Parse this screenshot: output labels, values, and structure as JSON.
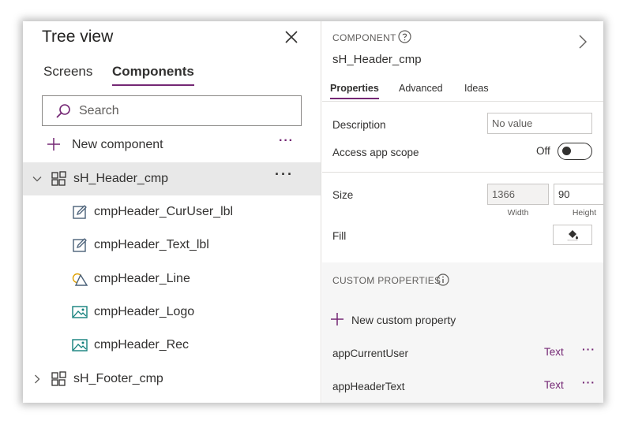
{
  "tree_view": {
    "title": "Tree view",
    "tabs": [
      {
        "label": "Screens",
        "active": false
      },
      {
        "label": "Components",
        "active": true
      }
    ],
    "search_placeholder": "Search",
    "new_component_label": "New component",
    "more_label": "···",
    "items": [
      {
        "name": "sH_Header_cmp",
        "type": "component",
        "expanded": true,
        "selected": true,
        "more": "···"
      },
      {
        "name": "cmpHeader_CurUser_lbl",
        "type": "label",
        "icon": "edit-label-icon"
      },
      {
        "name": "cmpHeader_Text_lbl",
        "type": "label",
        "icon": "edit-label-icon"
      },
      {
        "name": "cmpHeader_Line",
        "type": "shape",
        "icon": "shapes-icon"
      },
      {
        "name": "cmpHeader_Logo",
        "type": "image",
        "icon": "image-icon"
      },
      {
        "name": "cmpHeader_Rec",
        "type": "image",
        "icon": "image-icon"
      },
      {
        "name": "sH_Footer_cmp",
        "type": "component",
        "expanded": false,
        "selected": false
      }
    ]
  },
  "properties_panel": {
    "section_label": "COMPONENT",
    "component_name": "sH_Header_cmp",
    "tabs": [
      {
        "label": "Properties",
        "active": true
      },
      {
        "label": "Advanced",
        "active": false
      },
      {
        "label": "Ideas",
        "active": false
      }
    ],
    "description": {
      "label": "Description",
      "placeholder": "No value"
    },
    "access_app_scope": {
      "label": "Access app scope",
      "state_text": "Off",
      "on": false
    },
    "size": {
      "label": "Size",
      "width": "1366",
      "width_label": "Width",
      "height": "90",
      "height_label": "Height"
    },
    "fill": {
      "label": "Fill",
      "icon": "paint-bucket-icon"
    },
    "custom_properties": {
      "title": "CUSTOM PROPERTIES",
      "new_label": "New custom property",
      "items": [
        {
          "name": "appCurrentUser",
          "type": "Text",
          "more": "···"
        },
        {
          "name": "appHeaderText",
          "type": "Text",
          "more": "···"
        }
      ]
    }
  },
  "colors": {
    "accent": "#742774",
    "selected_row": "#e8e8e8",
    "label_icon": "#4a6078",
    "image_icon": "#13807c",
    "shape_icon": "#e0a100"
  }
}
